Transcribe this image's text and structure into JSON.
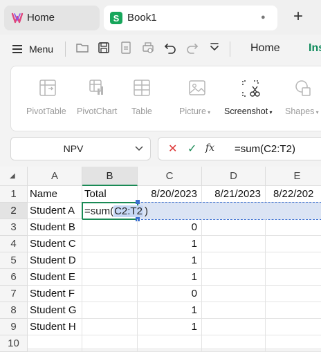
{
  "tabs": {
    "home_label": "Home",
    "book_label": "Book1",
    "book_modified_dot": "●",
    "new_tab": "+"
  },
  "toolbar": {
    "menu_label": "Menu",
    "ribbon_tabs": [
      "Home",
      "Ins"
    ]
  },
  "ribbon": {
    "items": [
      {
        "label": "PivotTable",
        "icon": "pivot-table-icon",
        "dropdown": false
      },
      {
        "label": "PivotChart",
        "icon": "pivot-chart-icon",
        "dropdown": false
      },
      {
        "label": "Table",
        "icon": "table-icon",
        "dropdown": false
      },
      {
        "label": "Picture",
        "icon": "picture-icon",
        "dropdown": true
      },
      {
        "label": "Screenshot",
        "icon": "screenshot-icon",
        "dropdown": true
      },
      {
        "label": "Shapes",
        "icon": "shapes-icon",
        "dropdown": true
      }
    ]
  },
  "formula_bar": {
    "name_box": "NPV",
    "cancel": "✕",
    "enter": "✓",
    "fx": "fx",
    "formula": "=sum(C2:T2)"
  },
  "sheet": {
    "corner": "◢",
    "columns": [
      "A",
      "B",
      "C",
      "D",
      "E"
    ],
    "rows": [
      "1",
      "2",
      "3",
      "4",
      "5",
      "6",
      "7",
      "8",
      "9",
      "10"
    ],
    "cells": {
      "A": [
        "Name",
        "Student A",
        "Student B",
        "Student C",
        "Student D",
        "Student E",
        "Student F",
        "Student G",
        "Student H"
      ],
      "B1": "Total",
      "C1": "8/20/2023",
      "D1": "8/21/2023",
      "E1": "8/22/202",
      "C": [
        "",
        "0",
        "1",
        "1",
        "1",
        "0",
        "1",
        "1"
      ]
    },
    "editing": {
      "prefix": "=sum(",
      "reference": "C2:T2",
      "suffix": ")"
    }
  },
  "colors": {
    "accent_green": "#1a8a55",
    "selection_blue": "#dbe4f4",
    "cancel_red": "#d33"
  }
}
